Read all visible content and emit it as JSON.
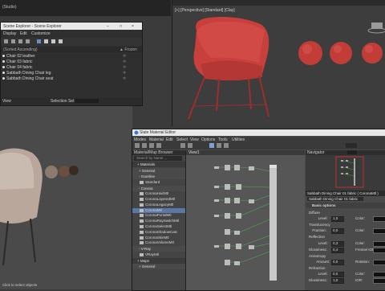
{
  "topbar": {
    "studio_text": "(Studio)"
  },
  "viewport_right": {
    "label": "[+] [Perspective] [Standard] [Clay]"
  },
  "scene_explorer": {
    "title": "Scene Explorer - Scene Explorer",
    "menu": [
      "Display",
      "Edit",
      "Customize"
    ],
    "column_header": "(Sorted Ascending)",
    "frozen_header": "▲ Frozen",
    "rows": [
      {
        "label": "Chair 02 leather"
      },
      {
        "label": "Chair 03 fabric"
      },
      {
        "label": "Chair 04 fabric"
      },
      {
        "label": "Sabbath Dining Chair leg"
      },
      {
        "label": "Sabbath Dining Chair seat"
      }
    ],
    "bottom_left": "View",
    "bottom_selection": "Selection Set:"
  },
  "material_editor": {
    "title": "Slate Material Editor",
    "menu": [
      "Modes",
      "Material",
      "Edit",
      "Select",
      "View",
      "Options",
      "Tools",
      "Utilities"
    ],
    "browser_title": "Material/Map Browser",
    "search_placeholder": "Search by Name ...",
    "browser_items": [
      {
        "kind": "section",
        "label": "+ Materials"
      },
      {
        "kind": "sub",
        "label": "+ General"
      },
      {
        "kind": "sub",
        "label": "- Scanline"
      },
      {
        "kind": "item",
        "label": "Standard"
      },
      {
        "kind": "sub",
        "label": "- Corona"
      },
      {
        "kind": "item",
        "label": "CoronaHairMtl"
      },
      {
        "kind": "item",
        "label": "CoronaLayeredMtl"
      },
      {
        "kind": "item",
        "label": "CoronaLegacyMtl"
      },
      {
        "kind": "item",
        "label": "CoronaMtl"
      },
      {
        "kind": "item",
        "label": "CoronaPortalMtl"
      },
      {
        "kind": "item",
        "label": "CoronaRaySwitchMtl"
      },
      {
        "kind": "item",
        "label": "CoronaSelectMtl"
      },
      {
        "kind": "item",
        "label": "CoronaShadowCatc"
      },
      {
        "kind": "item",
        "label": "CoronaSkinMtl"
      },
      {
        "kind": "item",
        "label": "CoronaVolumeMtl"
      },
      {
        "kind": "sub",
        "label": "- V-Ray"
      },
      {
        "kind": "item",
        "label": "VRayMtl"
      },
      {
        "kind": "section",
        "label": "+ Maps"
      },
      {
        "kind": "sub",
        "label": "+ General"
      }
    ],
    "view_tab": "View1",
    "navigator_title": "Navigator",
    "material_name": "Sabbath Dining Chair 01 fabric  ( CoronaMtl )",
    "material_sub": "Sabbath Dining Chair 01 fabric",
    "params": [
      {
        "kind": "section",
        "label": "Basic options"
      },
      {
        "kind": "label",
        "label": "Diffuse"
      },
      {
        "kind": "field",
        "label": "Level:",
        "value": "1,0",
        "extra": "Color:"
      },
      {
        "kind": "label",
        "label": "Translucency"
      },
      {
        "kind": "field",
        "label": "Fraction:",
        "value": "0,0",
        "extra": "Color:"
      },
      {
        "kind": "label",
        "label": "Reflection"
      },
      {
        "kind": "field",
        "label": "Level:",
        "value": "0,3",
        "extra": "Color:"
      },
      {
        "kind": "field",
        "label": "Glossiness:",
        "value": "0,4",
        "extra": "Fresnel IOR:"
      },
      {
        "kind": "label",
        "label": "Anisotropy"
      },
      {
        "kind": "field",
        "label": "Amount:",
        "value": "0,0",
        "extra": "Rotation:"
      },
      {
        "kind": "label",
        "label": "Refraction"
      },
      {
        "kind": "field",
        "label": "Level:",
        "value": "0,0",
        "extra": "Color:"
      },
      {
        "kind": "field",
        "label": "Glossiness:",
        "value": "1,0",
        "extra": "IOR:"
      }
    ],
    "status": "Click to select objects"
  },
  "colors": {
    "chair_red": "#c8403c",
    "leg_red": "#9b2f2b",
    "fabric": "#b8a79a"
  }
}
